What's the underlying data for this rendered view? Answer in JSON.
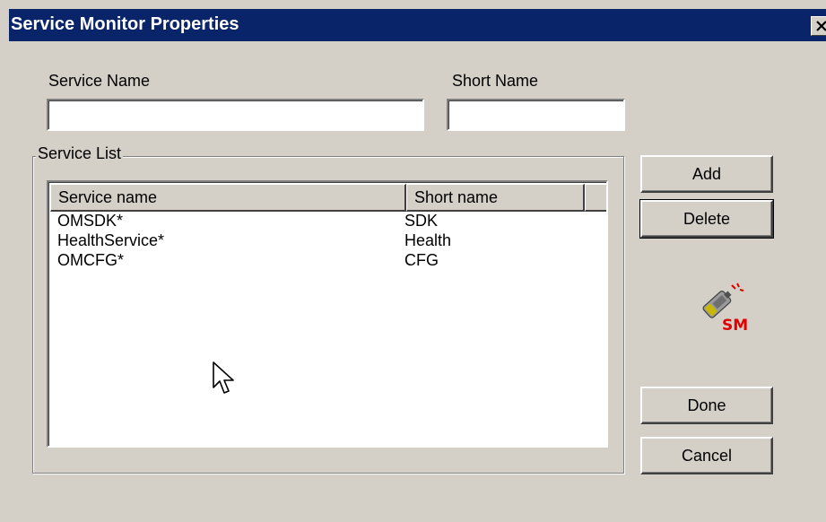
{
  "window": {
    "title": "Service Monitor Properties",
    "close_glyph": "close-icon"
  },
  "form": {
    "service_name_label": "Service Name",
    "service_name_value": "",
    "short_name_label": "Short Name",
    "short_name_value": ""
  },
  "service_list": {
    "caption": "Service List",
    "columns": [
      "Service name",
      "Short name"
    ],
    "rows": [
      {
        "service": "OMSDK*",
        "short": "SDK"
      },
      {
        "service": "HealthService*",
        "short": "Health"
      },
      {
        "service": "OMCFG*",
        "short": "CFG"
      }
    ]
  },
  "buttons": {
    "add": "Add",
    "delete": "Delete",
    "done": "Done",
    "cancel": "Cancel"
  },
  "logo": {
    "text": "SM",
    "icon": "service-monitor-logo-icon"
  },
  "colors": {
    "titlebar": "#0a246a",
    "face": "#d4d0c8",
    "logo_red": "#e00000"
  }
}
